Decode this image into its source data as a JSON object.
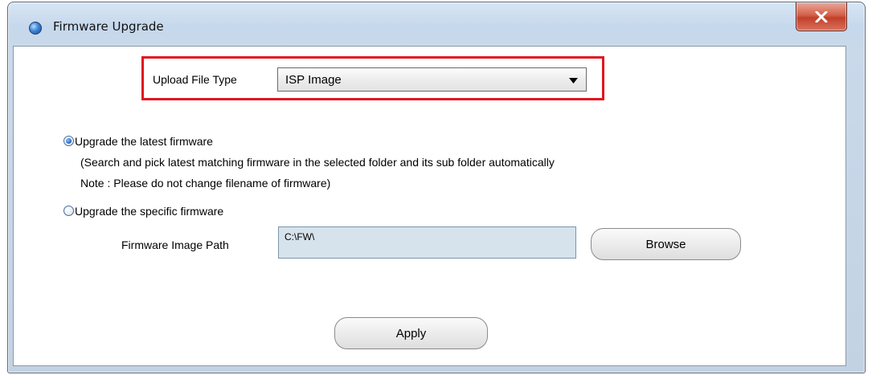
{
  "window": {
    "title": "Firmware Upgrade",
    "close_label": "X"
  },
  "upload_type": {
    "label": "Upload File Type",
    "selected": "ISP Image"
  },
  "options": {
    "latest": {
      "label": "Upgrade the latest firmware",
      "description_line1": "(Search and pick latest matching firmware in the selected folder and its sub folder automatically",
      "description_line2": "Note : Please do not change filename of firmware)",
      "checked": true
    },
    "specific": {
      "label": "Upgrade the specific firmware",
      "checked": false
    }
  },
  "firmware_path": {
    "label": "Firmware Image Path",
    "value": "C:\\FW\\"
  },
  "buttons": {
    "browse": "Browse",
    "apply": "Apply"
  },
  "colors": {
    "highlight_border": "#e0141e",
    "close_button": "#c9432d",
    "path_field_bg": "#d6e2ec"
  }
}
